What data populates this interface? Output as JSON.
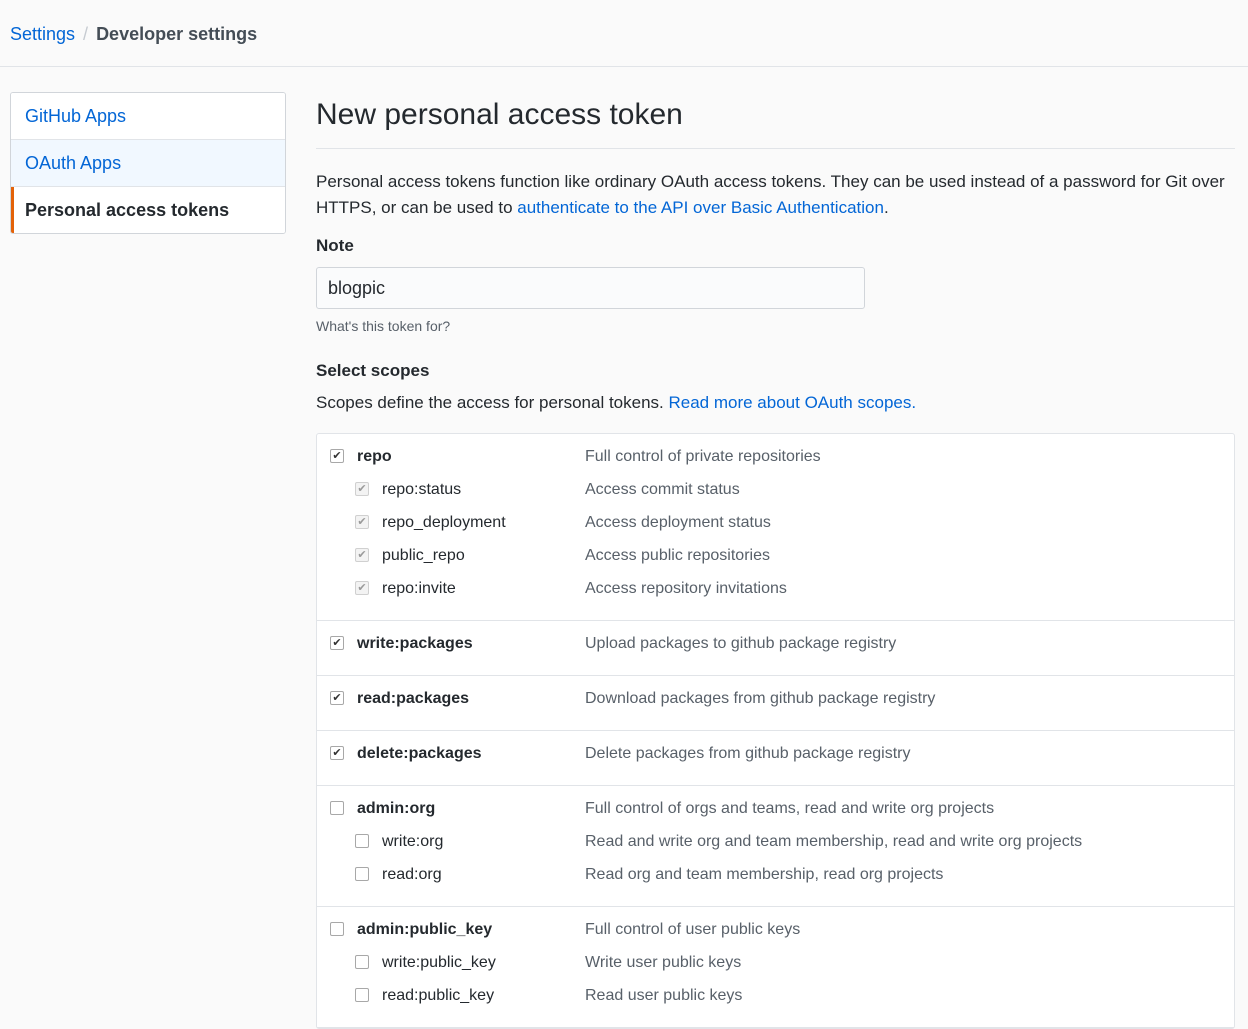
{
  "breadcrumb": {
    "parent": "Settings",
    "separator": "/",
    "current": "Developer settings"
  },
  "sidebar": {
    "items": [
      {
        "label": "GitHub Apps"
      },
      {
        "label": "OAuth Apps"
      },
      {
        "label": "Personal access tokens"
      }
    ]
  },
  "page": {
    "title": "New personal access token",
    "intro_text": "Personal access tokens function like ordinary OAuth access tokens. They can be used instead of a password for Git over HTTPS, or can be used to ",
    "intro_link": "authenticate to the API over Basic Authentication",
    "intro_end": "."
  },
  "note": {
    "label": "Note",
    "value": "blogpic",
    "hint": "What's this token for?"
  },
  "scopes": {
    "label": "Select scopes",
    "description": "Scopes define the access for personal tokens. ",
    "description_link": "Read more about OAuth scopes.",
    "groups": [
      {
        "name": "repo",
        "description": "Full control of private repositories",
        "checked": true,
        "children": [
          {
            "name": "repo:status",
            "description": "Access commit status",
            "checked": true
          },
          {
            "name": "repo_deployment",
            "description": "Access deployment status",
            "checked": true
          },
          {
            "name": "public_repo",
            "description": "Access public repositories",
            "checked": true
          },
          {
            "name": "repo:invite",
            "description": "Access repository invitations",
            "checked": true
          }
        ]
      },
      {
        "name": "write:packages",
        "description": "Upload packages to github package registry",
        "checked": true,
        "children": []
      },
      {
        "name": "read:packages",
        "description": "Download packages from github package registry",
        "checked": true,
        "children": []
      },
      {
        "name": "delete:packages",
        "description": "Delete packages from github package registry",
        "checked": true,
        "children": []
      },
      {
        "name": "admin:org",
        "description": "Full control of orgs and teams, read and write org projects",
        "checked": false,
        "children": [
          {
            "name": "write:org",
            "description": "Read and write org and team membership, read and write org projects",
            "checked": false
          },
          {
            "name": "read:org",
            "description": "Read org and team membership, read org projects",
            "checked": false
          }
        ]
      },
      {
        "name": "admin:public_key",
        "description": "Full control of user public keys",
        "checked": false,
        "children": [
          {
            "name": "write:public_key",
            "description": "Write user public keys",
            "checked": false
          },
          {
            "name": "read:public_key",
            "description": "Read user public keys",
            "checked": false
          }
        ]
      }
    ]
  },
  "colors": {
    "link": "#0366d6",
    "selected_accent": "#e36209",
    "border": "#e1e4e8"
  },
  "icons": {
    "checked": "check-mark",
    "unchecked": "empty-box"
  }
}
